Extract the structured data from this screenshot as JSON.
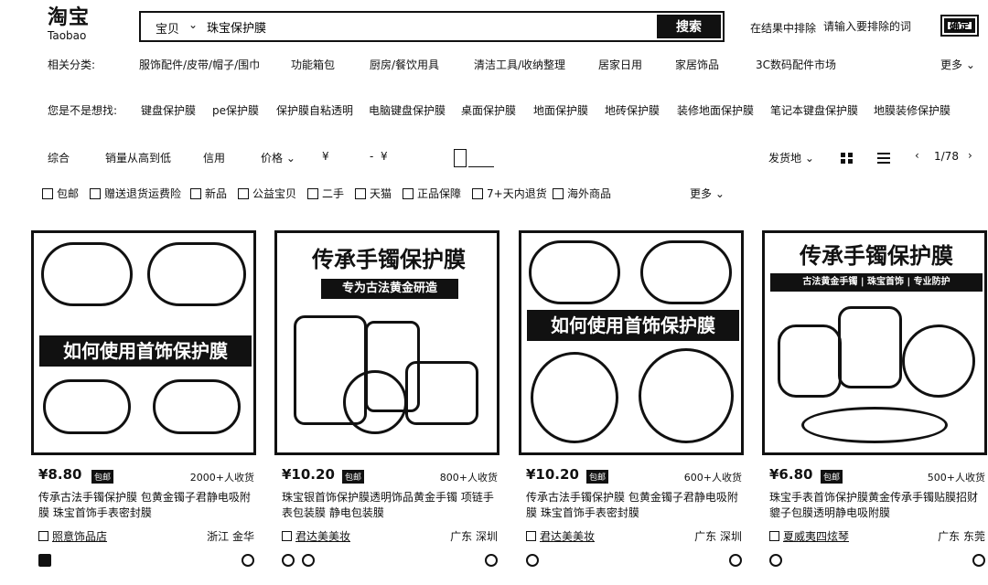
{
  "header": {
    "logo_cn": "淘宝",
    "logo_en": "Taobao",
    "search_scope": "宝贝",
    "search_value": "珠宝保护膜",
    "search_button": "搜索",
    "exclude_label": "在结果中排除",
    "exclude_placeholder": "请输入要排除的词",
    "confirm_button": "确定"
  },
  "related": {
    "label": "相关分类:",
    "items": [
      "服饰配件/皮带/帽子/围巾",
      "功能箱包",
      "厨房/餐饮用具",
      "清洁工具/收纳整理",
      "居家日用",
      "家居饰品",
      "3C数码配件市场"
    ],
    "more": "更多"
  },
  "suggest": {
    "label": "您是不是想找:",
    "items": [
      "键盘保护膜",
      "pe保护膜",
      "保护膜自粘透明",
      "电脑键盘保护膜",
      "桌面保护膜",
      "地面保护膜",
      "地砖保护膜",
      "装修地面保护膜",
      "笔记本键盘保护膜",
      "地膜装修保护膜"
    ]
  },
  "sort": {
    "comprehensive": "综合",
    "sales": "销量从高到低",
    "credit": "信用",
    "price": "价格",
    "currency": "¥",
    "dash": "-",
    "ship_from": "发货地",
    "page": "1/78"
  },
  "filters": [
    "包邮",
    "赠送退货运费险",
    "新品",
    "公益宝贝",
    "二手",
    "天猫",
    "正品保障",
    "7+天内退货",
    "海外商品"
  ],
  "filters_more": "更多",
  "products": [
    {
      "image_text": "如何使用首饰保护膜",
      "price": "¥8.80",
      "postage": "包邮",
      "sales": "2000+人收货",
      "title": "传承古法手镯保护膜 包黄金镯子君静电吸附膜 珠宝首饰手表密封膜",
      "shop": "照意饰品店",
      "location": "浙江 金华"
    },
    {
      "image_text": "传承手镯保护膜",
      "image_subtext": "专为古法黄金研造",
      "price": "¥10.20",
      "postage": "包邮",
      "sales": "800+人收货",
      "title": "珠宝银首饰保护膜透明饰品黄金手镯 项链手表包装膜 静电包装膜",
      "shop": "君达美美妆",
      "location": "广东 深圳"
    },
    {
      "image_text": "如何使用首饰保护膜",
      "price": "¥10.20",
      "postage": "包邮",
      "sales": "600+人收货",
      "title": "传承古法手镯保护膜 包黄金镯子君静电吸附膜 珠宝首饰手表密封膜",
      "shop": "君达美美妆",
      "location": "广东 深圳"
    },
    {
      "image_text": "传承手镯保护膜",
      "image_subtext": "古法黄金手镯 | 珠宝首饰 | 专业防护",
      "price": "¥6.80",
      "postage": "包邮",
      "sales": "500+人收货",
      "title": "珠宝手表首饰保护膜黄金传承手镯贴膜招财貔子包膜透明静电吸附膜",
      "shop": "夏威夷四炫琴",
      "location": "广东 东莞"
    }
  ]
}
